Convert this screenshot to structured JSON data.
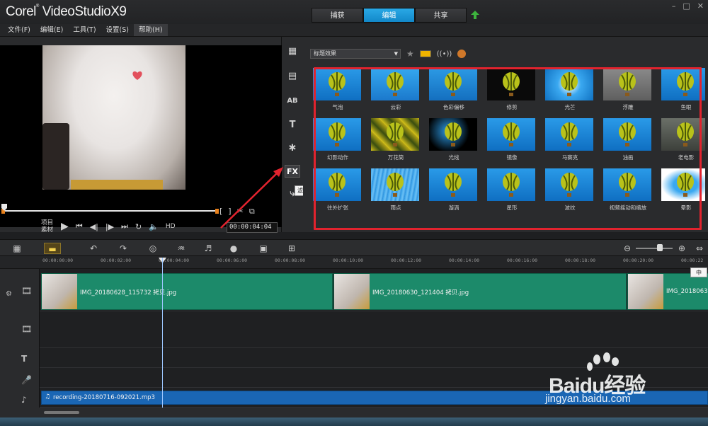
{
  "app": {
    "title": "Corel VideoStudio X9",
    "logo_brand": "Corel",
    "logo_product": "VideoStudioX9"
  },
  "mode_tabs": [
    {
      "label": "捕获",
      "active": false
    },
    {
      "label": "编辑",
      "active": true
    },
    {
      "label": "共享",
      "active": false
    }
  ],
  "menu": [
    {
      "label": "文件(F)"
    },
    {
      "label": "编辑(E)"
    },
    {
      "label": "工具(T)"
    },
    {
      "label": "设置(S)"
    },
    {
      "label": "帮助(H)",
      "active": true
    }
  ],
  "player": {
    "project_label": "项目",
    "clip_label": "素材",
    "hd_label": "HD",
    "timecode": "00:00:04:04"
  },
  "library": {
    "active_tool_label": "FX",
    "tooltip": "滤镜",
    "filter_category": "标题效果",
    "filters": [
      "气泡",
      "云彩",
      "色彩偏移",
      "修剪",
      "光芒",
      "浮雕",
      "鱼眼",
      "幻影动作",
      "万花筒",
      "光线",
      "镜像",
      "马赛克",
      "油画",
      "老电影",
      "往外扩张",
      "雨点",
      "漩涡",
      "星形",
      "波纹",
      "视频摇动和缩放",
      "晕影"
    ]
  },
  "timeline": {
    "ruler": [
      "00:00:00:00",
      "00:00:02:00",
      "00:00:04:00",
      "00:00:06:00",
      "00:00:08:00",
      "00:00:10:00",
      "00:00:12:00",
      "00:00:14:00",
      "00:00:16:00",
      "00:00:18:00",
      "00:00:20:00",
      "00:00:22"
    ],
    "video_clips": [
      {
        "name": "IMG_20180628_115732 拷贝.jpg"
      },
      {
        "name": "IMG_20180630_121404 拷贝.jpg"
      },
      {
        "name": "IMG_20180630"
      }
    ],
    "audio_clip": {
      "name": "recording-20180716-092021.mp3"
    },
    "ime_indicator": "中"
  },
  "watermark": {
    "text": "Baidu经验",
    "sub": "jingyan.baidu.com"
  },
  "colors": {
    "accent_tab": "#1a98da",
    "highlight_box": "#e2232e",
    "video_clip": "#1c8a6a",
    "audio_clip": "#1a66b4"
  }
}
